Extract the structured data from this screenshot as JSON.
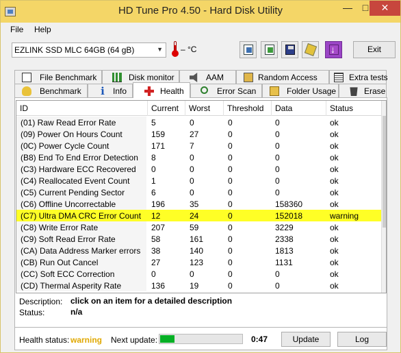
{
  "window": {
    "title": "HD Tune Pro 4.50 - Hard Disk Utility"
  },
  "menu": {
    "file": "File",
    "help": "Help"
  },
  "toolbar": {
    "drive": "EZLINK  SSD MLC 64GB (64 gB)",
    "temperature": "– °C",
    "exit_label": "Exit"
  },
  "tabs": {
    "row1": [
      "File Benchmark",
      "Disk monitor",
      "AAM",
      "Random Access",
      "Extra tests"
    ],
    "row2": [
      "Benchmark",
      "Info",
      "Health",
      "Error Scan",
      "Folder Usage",
      "Erase"
    ],
    "active": "Health"
  },
  "grid": {
    "columns": [
      "ID",
      "Current",
      "Worst",
      "Threshold",
      "Data",
      "Status"
    ],
    "rows": [
      {
        "id": "(01) Raw Read Error Rate",
        "current": "5",
        "worst": "0",
        "threshold": "0",
        "data": "0",
        "status": "ok"
      },
      {
        "id": "(09) Power On Hours Count",
        "current": "159",
        "worst": "27",
        "threshold": "0",
        "data": "0",
        "status": "ok"
      },
      {
        "id": "(0C) Power Cycle Count",
        "current": "171",
        "worst": "7",
        "threshold": "0",
        "data": "0",
        "status": "ok"
      },
      {
        "id": "(B8) End To End Error Detection",
        "current": "8",
        "worst": "0",
        "threshold": "0",
        "data": "0",
        "status": "ok"
      },
      {
        "id": "(C3) Hardware ECC Recovered",
        "current": "0",
        "worst": "0",
        "threshold": "0",
        "data": "0",
        "status": "ok"
      },
      {
        "id": "(C4) Reallocated Event Count",
        "current": "1",
        "worst": "0",
        "threshold": "0",
        "data": "0",
        "status": "ok"
      },
      {
        "id": "(C5) Current Pending Sector",
        "current": "6",
        "worst": "0",
        "threshold": "0",
        "data": "0",
        "status": "ok"
      },
      {
        "id": "(C6) Offline Uncorrectable",
        "current": "196",
        "worst": "35",
        "threshold": "0",
        "data": "158360",
        "status": "ok"
      },
      {
        "id": "(C7) Ultra DMA CRC Error Count",
        "current": "12",
        "worst": "24",
        "threshold": "0",
        "data": "152018",
        "status": "warning",
        "highlight": true
      },
      {
        "id": "(C8) Write Error Rate",
        "current": "207",
        "worst": "59",
        "threshold": "0",
        "data": "3229",
        "status": "ok"
      },
      {
        "id": "(C9) Soft Read Error Rate",
        "current": "58",
        "worst": "161",
        "threshold": "0",
        "data": "2338",
        "status": "ok"
      },
      {
        "id": "(CA) Data Address Marker errors",
        "current": "38",
        "worst": "140",
        "threshold": "0",
        "data": "1813",
        "status": "ok"
      },
      {
        "id": "(CB) Run Out Cancel",
        "current": "27",
        "worst": "123",
        "threshold": "0",
        "data": "1131",
        "status": "ok"
      },
      {
        "id": "(CC) Soft ECC Correction",
        "current": "0",
        "worst": "0",
        "threshold": "0",
        "data": "0",
        "status": "ok"
      },
      {
        "id": "(CD) Thermal Asperity Rate",
        "current": "136",
        "worst": "19",
        "threshold": "0",
        "data": "0",
        "status": "ok"
      }
    ]
  },
  "description": {
    "label": "Description:",
    "value": "click on an item for a detailed description",
    "status_label": "Status:",
    "status_value": "n/a"
  },
  "footer": {
    "health_label": "Health status:",
    "health_value": "warning",
    "next_update_label": "Next update:",
    "progress_fraction": 0.18,
    "time": "0:47",
    "update_label": "Update",
    "log_label": "Log"
  },
  "colors": {
    "highlight_row": "#ffff26",
    "warning_text": "#e0a800",
    "titlebar": "#f4d667",
    "progress": "#06b025"
  }
}
